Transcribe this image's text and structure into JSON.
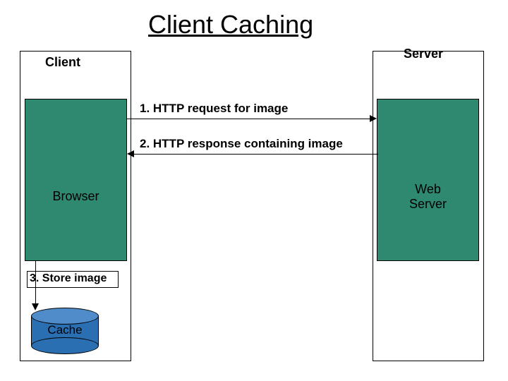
{
  "title": "Client Caching",
  "client": {
    "label": "Client"
  },
  "server": {
    "label": "Server"
  },
  "browser": {
    "label": "Browser"
  },
  "webserver": {
    "line1": "Web",
    "line2": "Server"
  },
  "messages": {
    "m1": "1. HTTP request for image",
    "m2": "2. HTTP response containing image",
    "m3": "3. Store image"
  },
  "cache": {
    "label": "Cache"
  },
  "colors": {
    "boxFill": "#2e8970",
    "cylFill": "#2b6fb3"
  }
}
